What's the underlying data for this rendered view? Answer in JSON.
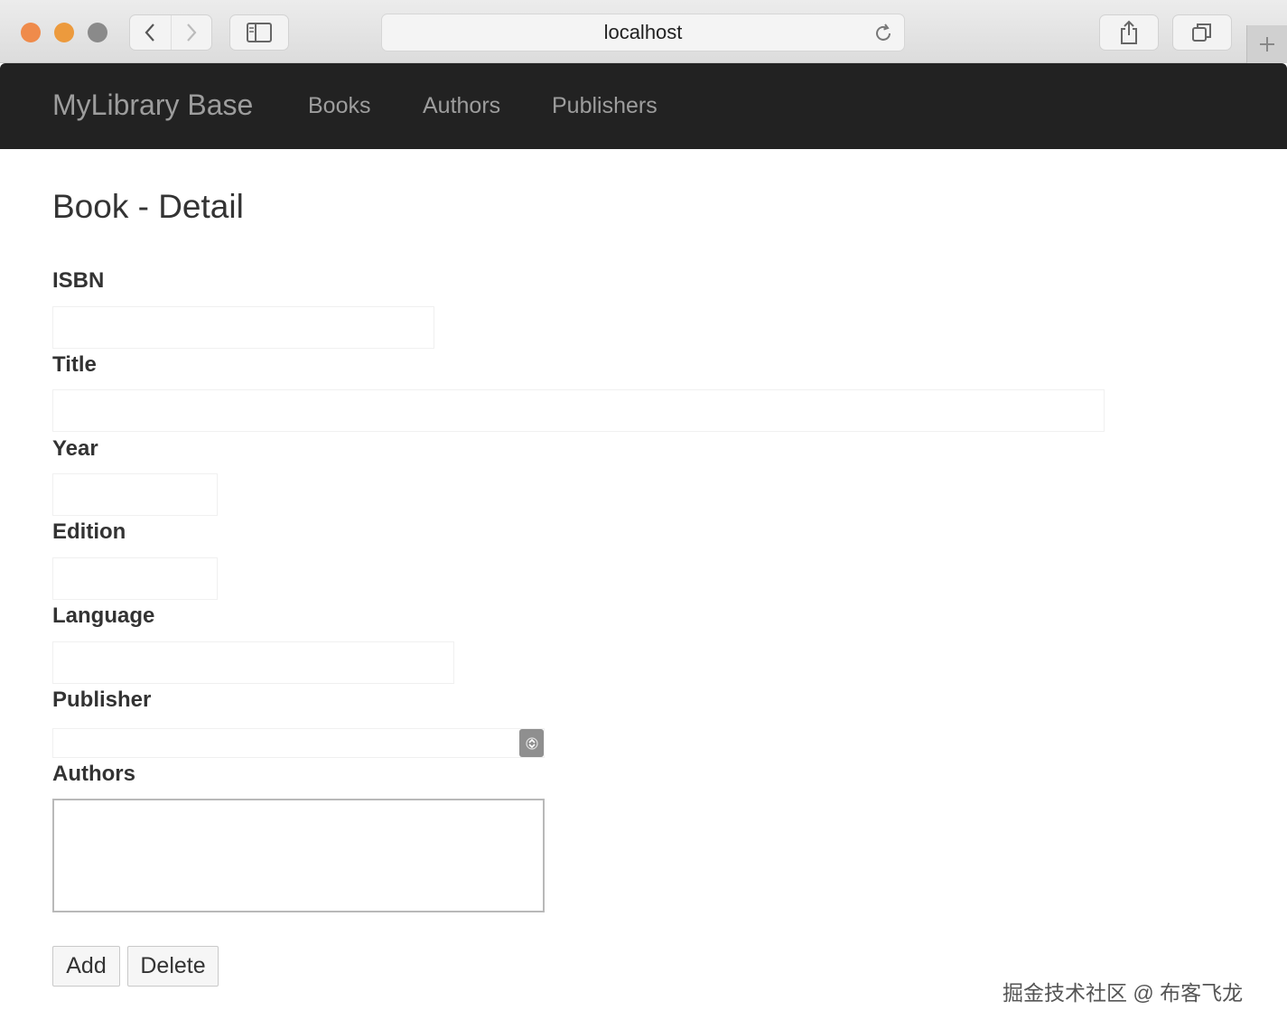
{
  "browser": {
    "url": "localhost",
    "colors": {
      "close": "#ef8b4b",
      "minimize": "#ec9a3d",
      "zoom": "#8a8a8a"
    }
  },
  "navbar": {
    "brand": "MyLibrary Base",
    "links": [
      "Books",
      "Authors",
      "Publishers"
    ]
  },
  "page": {
    "title": "Book - Detail"
  },
  "form": {
    "isbn": {
      "label": "ISBN",
      "value": ""
    },
    "title": {
      "label": "Title",
      "value": ""
    },
    "year": {
      "label": "Year",
      "value": ""
    },
    "edition": {
      "label": "Edition",
      "value": ""
    },
    "language": {
      "label": "Language",
      "value": ""
    },
    "publisher": {
      "label": "Publisher",
      "selected": ""
    },
    "authors": {
      "label": "Authors",
      "items": []
    }
  },
  "buttons": {
    "add": "Add",
    "delete": "Delete"
  },
  "watermark": "掘金技术社区 @ 布客飞龙"
}
